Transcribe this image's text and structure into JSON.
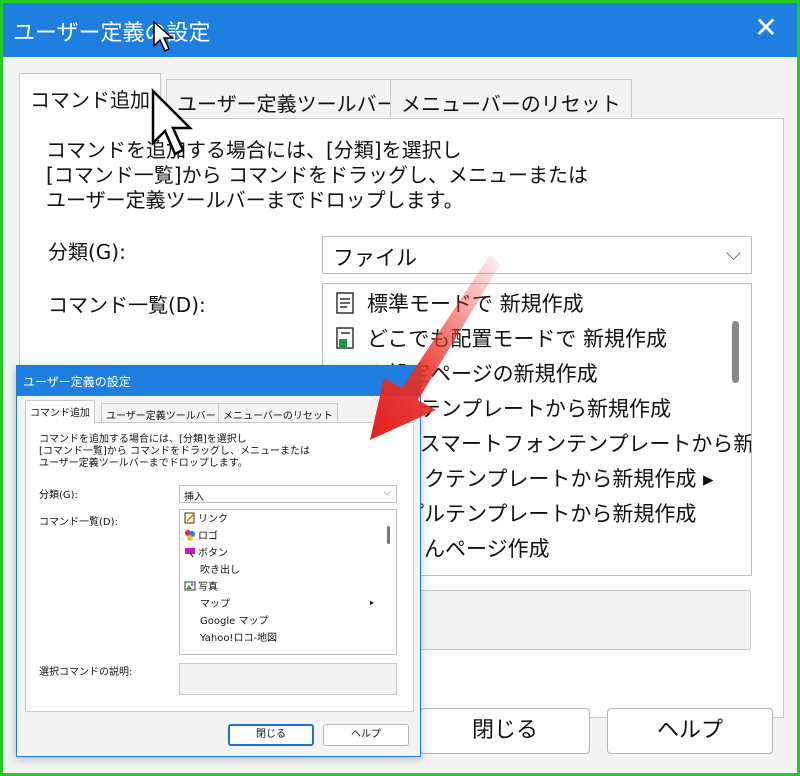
{
  "big_dialog": {
    "title": "ユーザー定義の設定",
    "close_glyph": "✕",
    "tabs": [
      {
        "label": "コマンド追加",
        "active": true
      },
      {
        "label": "ユーザー定義ツールバー",
        "active": false
      },
      {
        "label": "メニューバーのリセット",
        "active": false
      }
    ],
    "description": "コマンドを追加する場合には、[分類]を選択し\n[コマンド一覧]から コマンドをドラッグし、メニューまたは\nユーザー定義ツールバーまでドロップします。",
    "category_label": "分類(G):",
    "category_value": "ファイル",
    "command_list_label": "コマンド一覧(D):",
    "commands": [
      {
        "label": "標準モードで 新規作成",
        "icon": "page-icon"
      },
      {
        "label": "どこでも配置モードで 新規作成",
        "icon": "page-green-icon"
      },
      {
        "label": "ム設定ページの新規作成",
        "icon": "folder-icon"
      },
      {
        "label": "SSテンプレートから新規作成",
        "icon": ""
      },
      {
        "label": "SSスマートフォンテンプレートから新",
        "icon": ""
      },
      {
        "label": "ックテンプレートから新規作成 ▸",
        "icon": ""
      },
      {
        "label": "プルテンプレートから新規作成",
        "icon": ""
      },
      {
        "label": "きんページ作成",
        "icon": ""
      }
    ],
    "close_button": "閉じる",
    "help_button": "ヘルプ"
  },
  "small_dialog": {
    "title": "ユーザー定義の設定",
    "tabs": [
      {
        "label": "コマンド追加",
        "active": true
      },
      {
        "label": "ユーザー定義ツールバー",
        "active": false
      },
      {
        "label": "メニューバーのリセット",
        "active": false
      }
    ],
    "description": "コマンドを追加する場合には、[分類]を選択し\n[コマンド一覧]から コマンドをドラッグし、メニューまたは\nユーザー定義ツールバーまでドロップします。",
    "category_label": "分類(G):",
    "category_value": "挿入",
    "command_list_label": "コマンド一覧(D):",
    "commands": [
      {
        "label": "リンク",
        "icon": "link-icon"
      },
      {
        "label": "ロゴ",
        "icon": "logo-icon"
      },
      {
        "label": "ボタン",
        "icon": "button-icon"
      },
      {
        "label": "吹き出し",
        "icon": ""
      },
      {
        "label": "写真",
        "icon": "photo-icon"
      },
      {
        "label": "マップ",
        "icon": ""
      },
      {
        "label": "Google マップ",
        "icon": ""
      },
      {
        "label": "Yahoo!ロコ-地図",
        "icon": ""
      }
    ],
    "submenu_arrow": "▸",
    "selected_command_label": "選択コマンドの説明:",
    "close_button": "閉じる",
    "help_button": "ヘルプ"
  },
  "colors": {
    "title_bar": "#1e7fe0",
    "frame": "#22cc22",
    "arrow": "#e8332a"
  }
}
